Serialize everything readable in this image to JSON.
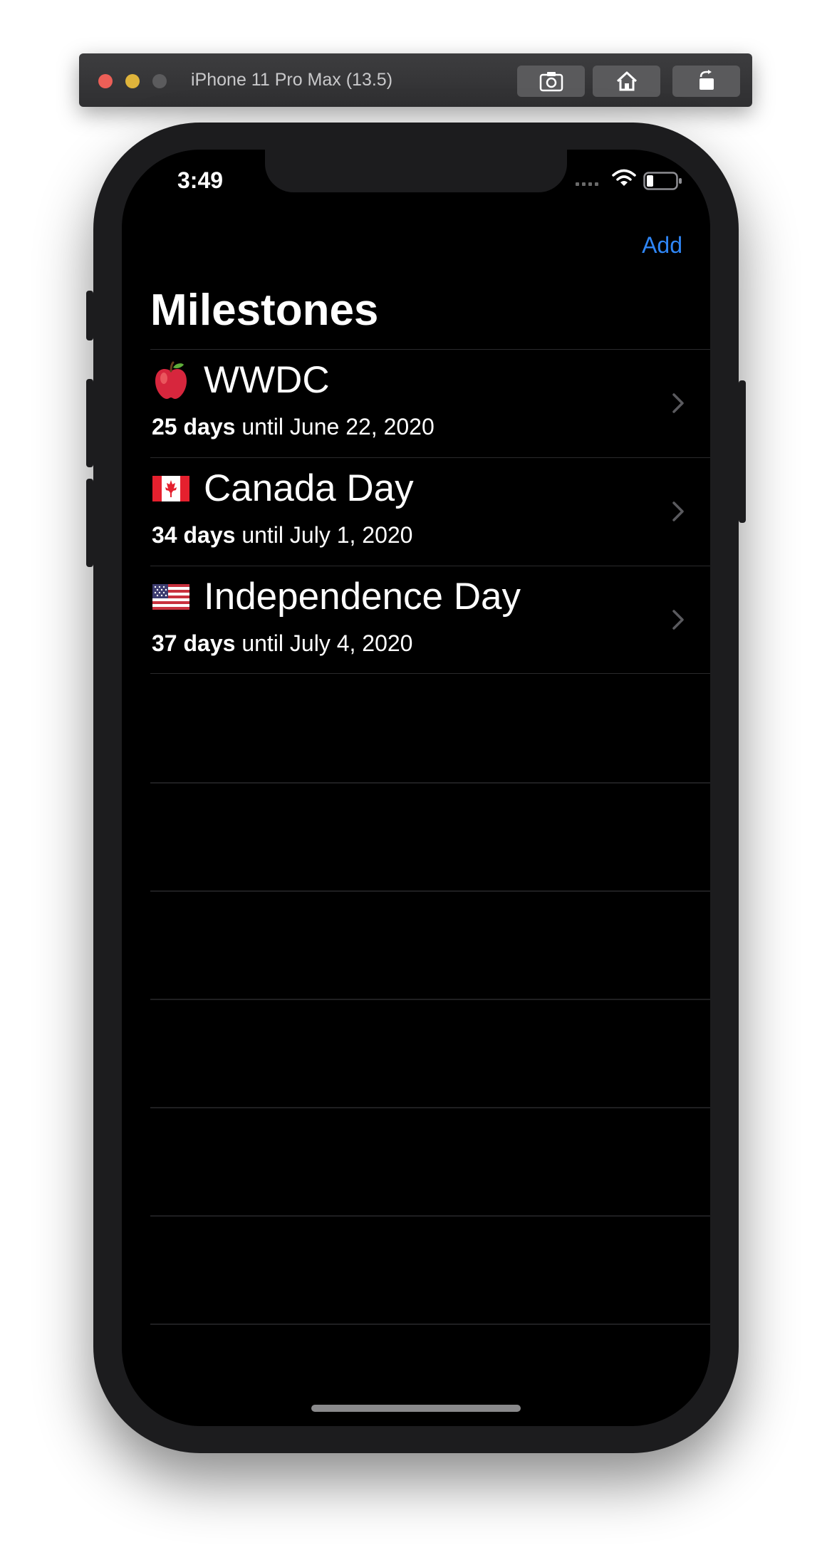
{
  "simulator": {
    "title": "iPhone 11 Pro Max (13.5)",
    "buttons": [
      "screenshot-icon",
      "home-icon",
      "rotate-icon"
    ]
  },
  "status_bar": {
    "time": "3:49"
  },
  "nav": {
    "add_label": "Add",
    "title": "Milestones"
  },
  "milestones": [
    {
      "emoji": "apple-icon",
      "title": "WWDC",
      "days": "25 days",
      "until": " until June 22, 2020"
    },
    {
      "emoji": "canada-flag-icon",
      "title": "Canada Day",
      "days": "34 days",
      "until": " until July 1, 2020"
    },
    {
      "emoji": "us-flag-icon",
      "title": "Independence Day",
      "days": "37 days",
      "until": " until July 4, 2020"
    }
  ],
  "colors": {
    "accent": "#2f86f6",
    "background": "#000000",
    "device": "#1c1c1e"
  }
}
